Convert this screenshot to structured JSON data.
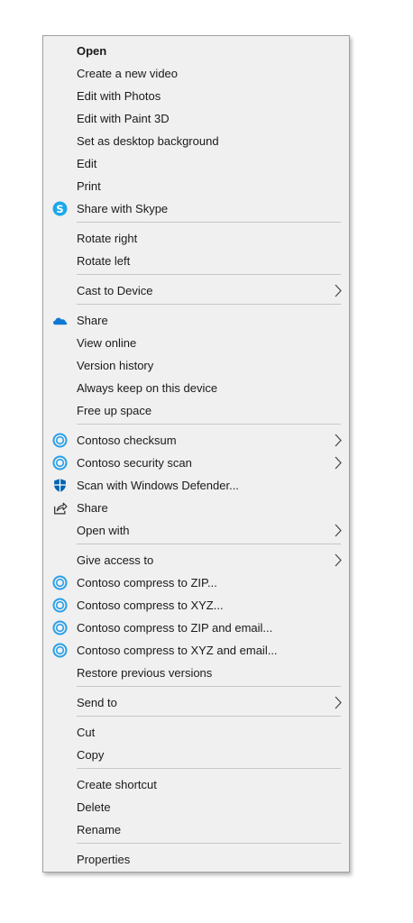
{
  "menu": {
    "open": "Open",
    "create_video": "Create a new video",
    "edit_photos": "Edit with Photos",
    "edit_paint3d": "Edit with Paint 3D",
    "set_desktop_bg": "Set as desktop background",
    "edit": "Edit",
    "print": "Print",
    "share_skype": "Share with Skype",
    "rotate_right": "Rotate right",
    "rotate_left": "Rotate left",
    "cast_device": "Cast to Device",
    "onedrive_share": "Share",
    "view_online": "View online",
    "version_history": "Version history",
    "always_keep": "Always keep on this device",
    "free_space": "Free up space",
    "contoso_checksum": "Contoso checksum",
    "contoso_security": "Contoso security scan",
    "scan_defender": "Scan with Windows Defender...",
    "share": "Share",
    "open_with": "Open with",
    "give_access": "Give access to",
    "compress_zip": "Contoso compress to ZIP...",
    "compress_xyz": "Contoso compress to XYZ...",
    "compress_zip_email": "Contoso compress to ZIP and email...",
    "compress_xyz_email": "Contoso compress to XYZ and email...",
    "restore_versions": "Restore previous versions",
    "send_to": "Send to",
    "cut": "Cut",
    "copy": "Copy",
    "create_shortcut": "Create shortcut",
    "delete": "Delete",
    "rename": "Rename",
    "properties": "Properties"
  },
  "icons": {
    "skype": "skype-icon",
    "onedrive": "onedrive-cloud-icon",
    "contoso": "contoso-ring-icon",
    "defender": "defender-shield-icon",
    "share": "share-arrow-icon",
    "submenu": "chevron-right-icon"
  },
  "colors": {
    "menu_background": "#f0f0f0",
    "menu_border": "#a0a0a0",
    "separator": "#c6c6c6",
    "text": "#1a1a1a",
    "skype_blue": "#1ba8ec",
    "onedrive_blue": "#0f78d4",
    "contoso_blue": "#2aa0e8",
    "defender_blue": "#0063b1"
  }
}
